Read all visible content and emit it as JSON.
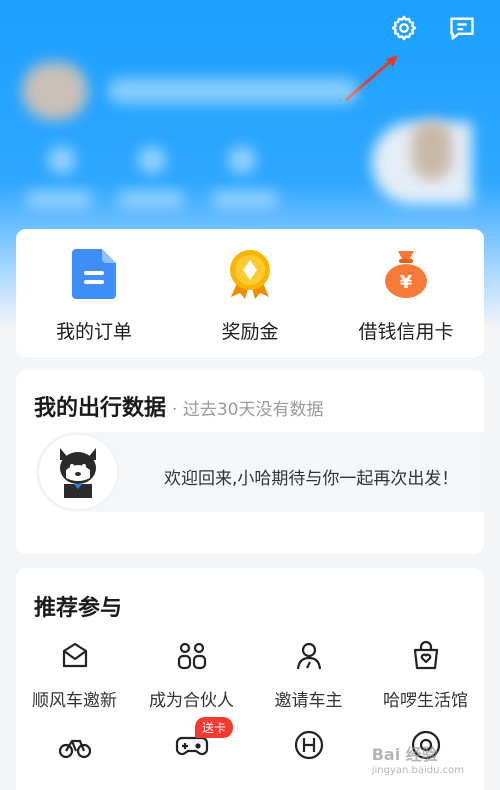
{
  "header": {
    "settings_icon": "gear-icon",
    "message_icon": "message-icon"
  },
  "quick_actions": [
    {
      "label": "我的订单",
      "icon": "document-icon",
      "color": "#3f8ef8"
    },
    {
      "label": "奖励金",
      "icon": "medal-icon",
      "color": "#f7b500"
    },
    {
      "label": "借钱信用卡",
      "icon": "money-bag-icon",
      "color": "#f77a39"
    }
  ],
  "travel": {
    "title": "我的出行数据",
    "subtitle": "· 过去30天没有数据",
    "welcome": "欢迎回来,小哈期待与你一起再次出发！"
  },
  "recommend": {
    "title": "推荐参与",
    "items": [
      {
        "label": "顺风车邀新",
        "icon": "envelope-icon"
      },
      {
        "label": "成为合伙人",
        "icon": "partner-icon"
      },
      {
        "label": "邀请车主",
        "icon": "person-icon"
      },
      {
        "label": "哈啰生活馆",
        "icon": "shopping-bag-icon"
      }
    ],
    "row2": [
      {
        "icon": "bicycle-icon"
      },
      {
        "icon": "gamepad-icon",
        "badge": "送卡"
      },
      {
        "icon": "hello-h-icon"
      },
      {
        "icon": "camera-icon"
      }
    ]
  },
  "watermark": {
    "text": "Bai 经验",
    "sub": "jingyan.baidu.com"
  },
  "colors": {
    "brand_blue": "#1ba0ff",
    "badge_red": "#f23a2f"
  }
}
